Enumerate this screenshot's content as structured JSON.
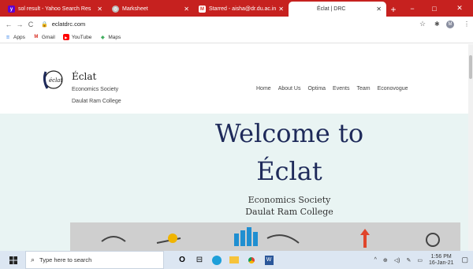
{
  "browser": {
    "tabs": [
      {
        "label": "sol result - Yahoo Search Res",
        "fav_color": "#6001d2",
        "fav_glyph": "y"
      },
      {
        "label": "Marksheet",
        "fav_color": "#888888",
        "fav_glyph": "◎"
      },
      {
        "label": "Starred - aisha@dr.du.ac.in",
        "fav_color": "#ffffff",
        "fav_glyph": "M"
      },
      {
        "label": "Éclat | DRC",
        "fav_color": "#ffffff",
        "fav_glyph": ""
      }
    ],
    "new_tab": "+",
    "minimize": "−",
    "maximize": "□",
    "close": "✕",
    "url": "eclatdrc.com",
    "profile_initial": "M"
  },
  "bookmarks": [
    {
      "label": "Apps",
      "icon": "apps-icon"
    },
    {
      "label": "Gmail",
      "icon": "gmail-icon"
    },
    {
      "label": "YouTube",
      "icon": "youtube-icon"
    },
    {
      "label": "Maps",
      "icon": "maps-icon"
    }
  ],
  "site": {
    "brand": "Éclat",
    "society": "Economics Society",
    "college": "Daulat Ram College",
    "nav": [
      "Home",
      "About Us",
      "Optima",
      "Events",
      "Team",
      "Econovogue"
    ],
    "hero_line1": "Welcome to",
    "hero_line2": "Éclat",
    "hero_sub1": "Economics Society",
    "hero_sub2": "Daulat Ram College",
    "logo_text": "éclat"
  },
  "taskbar": {
    "search_placeholder": "Type here to search",
    "time": "1:56 PM",
    "date": "16-Jan-21"
  },
  "colors": {
    "titlebar": "#c6211f",
    "hero_bg": "#e9f4f3",
    "hero_title": "#1e2a5a"
  }
}
